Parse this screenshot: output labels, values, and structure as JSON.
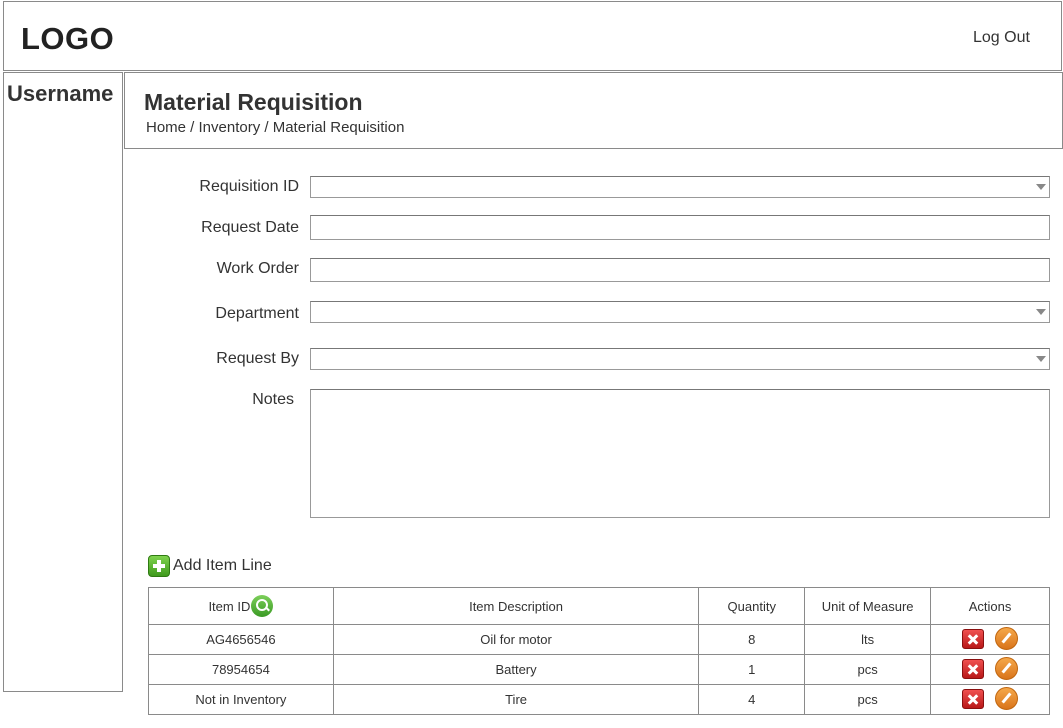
{
  "header": {
    "logo": "LOGO",
    "logout": "Log Out"
  },
  "sidebar": {
    "username": "Username"
  },
  "titlebar": {
    "title": "Material Requisition",
    "breadcrumb": "Home / Inventory / Material Requisition"
  },
  "form": {
    "requisition_id": {
      "label": "Requisition ID",
      "value": ""
    },
    "request_date": {
      "label": "Request Date",
      "value": ""
    },
    "work_order": {
      "label": "Work Order",
      "value": ""
    },
    "department": {
      "label": "Department",
      "value": ""
    },
    "request_by": {
      "label": "Request By",
      "value": ""
    },
    "notes": {
      "label": "Notes",
      "value": ""
    }
  },
  "add_item_label": "Add Item Line",
  "table": {
    "columns": [
      "Item ID",
      "Item Description",
      "Quantity",
      "Unit of Measure",
      "Actions"
    ],
    "rows": [
      [
        "AG4656546",
        "Oil for motor",
        "8",
        "lts"
      ],
      [
        "78954654",
        "Battery",
        "1",
        "pcs"
      ],
      [
        "Not in Inventory",
        "Tire",
        "4",
        "pcs"
      ]
    ]
  },
  "icons": {
    "add": "plus-icon",
    "search": "search-icon",
    "delete": "delete-icon",
    "edit": "edit-icon",
    "dropdown": "chevron-down-icon"
  },
  "colors": {
    "add_green": "#4caf2a",
    "delete_red": "#d32f2f",
    "edit_orange": "#e8892a"
  }
}
